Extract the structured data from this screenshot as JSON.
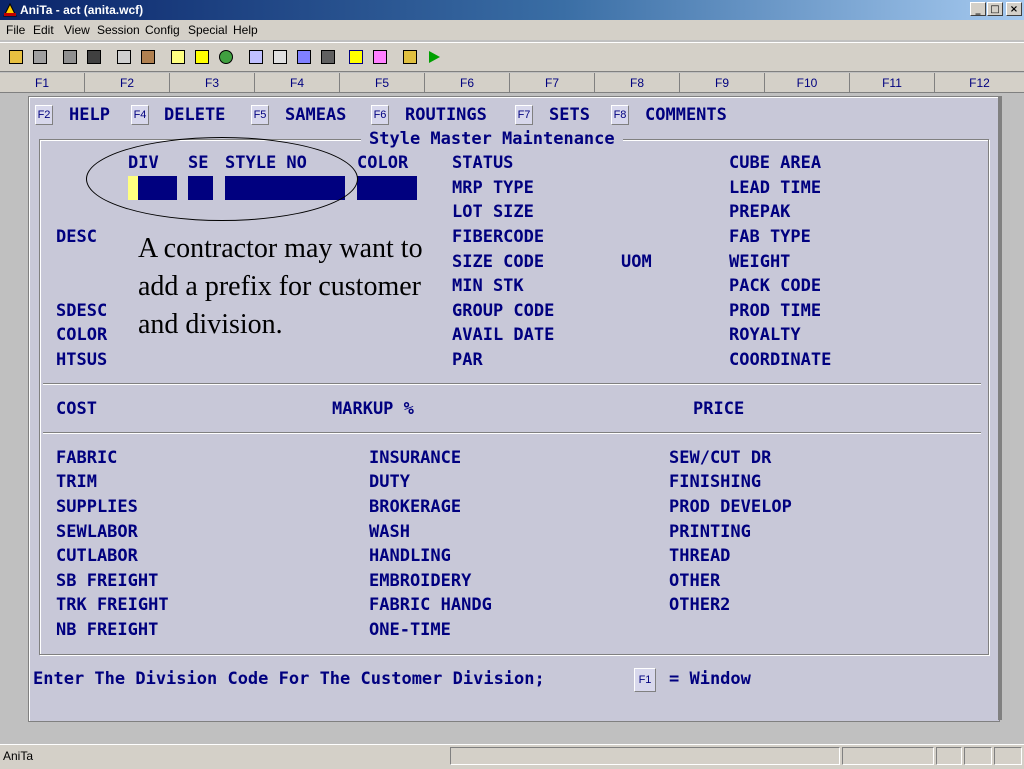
{
  "window": {
    "title": "AniTa - act (anita.wcf)"
  },
  "menu": [
    "File",
    "Edit",
    "View",
    "Session",
    "Config",
    "Special",
    "Help"
  ],
  "toolbar_icons": [
    "open-folder-icon",
    "save-icon",
    "copy-icon",
    "paste-icon",
    "print-icon",
    "print-preview-icon",
    "window-icon",
    "info-icon",
    "refresh-icon",
    "computer-icon",
    "calculator-icon",
    "font-icon",
    "keyboard-icon",
    "help-arrow-icon",
    "dos-icon",
    "database-icon",
    "play-icon"
  ],
  "fkeys": [
    "F1",
    "F2",
    "F3",
    "F4",
    "F5",
    "F6",
    "F7",
    "F8",
    "F9",
    "F10",
    "F11",
    "F12"
  ],
  "cmds": [
    {
      "key": "F2",
      "label": "HELP"
    },
    {
      "key": "F4",
      "label": "DELETE"
    },
    {
      "key": "F5",
      "label": "SAMEAS"
    },
    {
      "key": "F6",
      "label": "ROUTINGS"
    },
    {
      "key": "F7",
      "label": "SETS"
    },
    {
      "key": "F8",
      "label": "COMMENTS"
    }
  ],
  "form": {
    "title": "Style Master Maintenance",
    "key_labels": {
      "div": "DIV",
      "se": "SE",
      "style_no": "STYLE NO",
      "color": "COLOR"
    },
    "left_labels": {
      "desc": "DESC",
      "sdesc": "SDESC",
      "color": "COLOR",
      "htsus": "HTSUS"
    },
    "mid_labels": [
      "STATUS",
      "MRP TYPE",
      "LOT SIZE",
      "FIBERCODE",
      "SIZE CODE",
      "MIN STK",
      "GROUP CODE",
      "AVAIL DATE",
      "PAR"
    ],
    "uom_label": "UOM",
    "right_labels": [
      "CUBE AREA",
      "LEAD TIME",
      "PREPAK",
      "FAB TYPE",
      "WEIGHT",
      "PACK CODE",
      "PROD TIME",
      "ROYALTY",
      "COORDINATE"
    ],
    "cost_row": {
      "cost": "COST",
      "markup": "MARKUP %",
      "price": "PRICE"
    },
    "cost_col1": [
      "FABRIC",
      "TRIM",
      "SUPPLIES",
      "SEWLABOR",
      "CUTLABOR",
      "SB FREIGHT",
      "TRK FREIGHT",
      "NB FREIGHT"
    ],
    "cost_col2": [
      "INSURANCE",
      "DUTY",
      "BROKERAGE",
      "WASH",
      "HANDLING",
      "EMBROIDERY",
      "FABRIC HANDG",
      "ONE-TIME"
    ],
    "cost_col3": [
      "SEW/CUT DR",
      "FINISHING",
      "PROD DEVELOP",
      "PRINTING",
      "THREAD",
      "OTHER",
      "OTHER2"
    ]
  },
  "prompt": {
    "text": "Enter The Division Code For The Customer Division;",
    "key": "F1",
    "suffix": "= Window"
  },
  "callout": "A contractor may want to add a prefix for customer and division.",
  "status": {
    "app": "AniTa"
  },
  "colors": {
    "field": "#00007f",
    "text": "#00007f",
    "screen_bg": "#c8c8d8",
    "cursor": "#ffff80"
  }
}
